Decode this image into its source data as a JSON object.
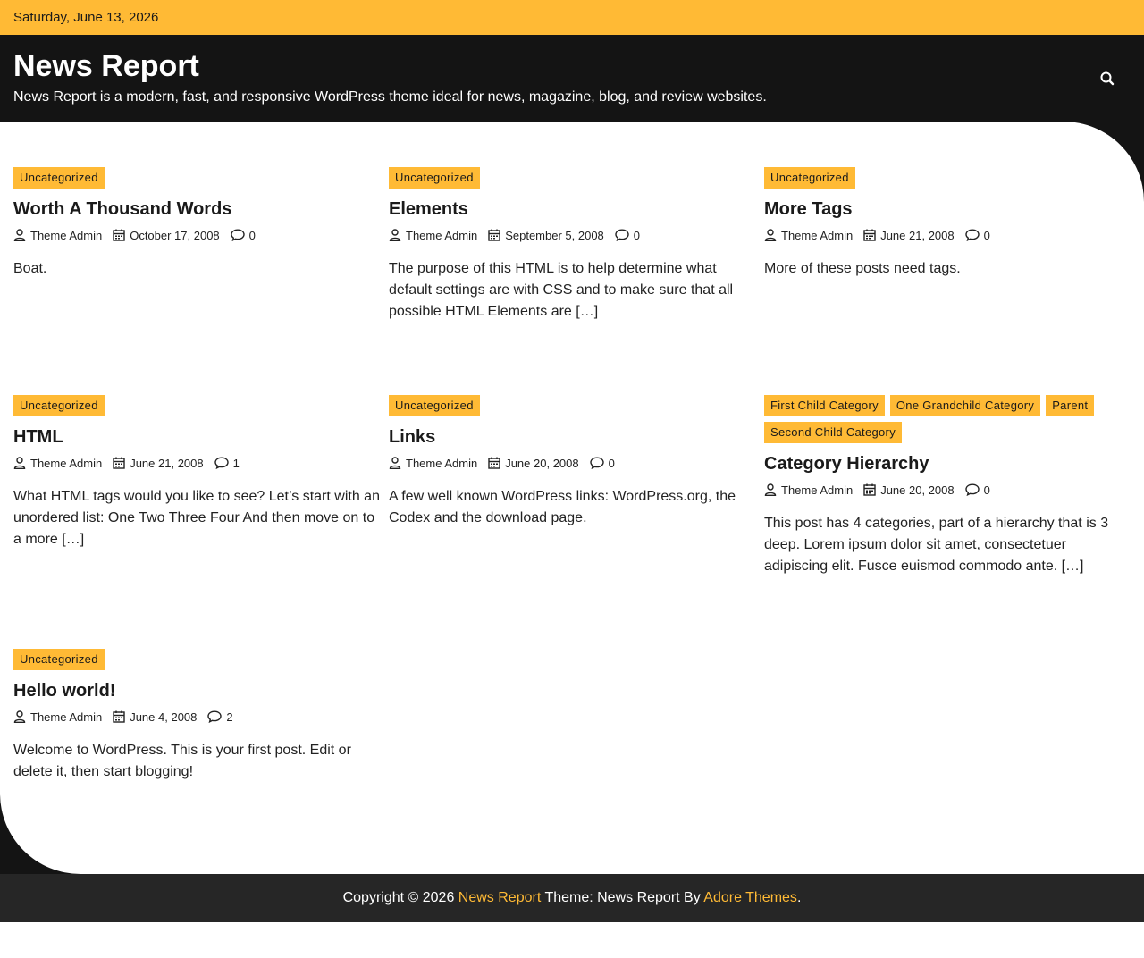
{
  "topbar": {
    "date": "Saturday, June 13, 2026"
  },
  "header": {
    "title": "News Report",
    "description": "News Report is a modern, fast, and responsive WordPress theme ideal for news, magazine, blog, and review websites.",
    "search_icon": "search-icon"
  },
  "colors": {
    "accent": "#ffba35",
    "dark": "#141414",
    "footer": "#262626"
  },
  "posts": [
    {
      "categories": [
        "Uncategorized"
      ],
      "title": "Worth A Thousand Words",
      "author": "Theme Admin",
      "date": "October 17, 2008",
      "comments": "0",
      "excerpt": "Boat."
    },
    {
      "categories": [
        "Uncategorized"
      ],
      "title": "Elements",
      "author": "Theme Admin",
      "date": "September 5, 2008",
      "comments": "0",
      "excerpt": "The purpose of this HTML is to help determine what default settings are with CSS and to make sure that all possible HTML Elements are […]"
    },
    {
      "categories": [
        "Uncategorized"
      ],
      "title": "More Tags",
      "author": "Theme Admin",
      "date": "June 21, 2008",
      "comments": "0",
      "excerpt": "More of these posts need tags."
    },
    {
      "categories": [
        "Uncategorized"
      ],
      "title": "HTML",
      "author": "Theme Admin",
      "date": "June 21, 2008",
      "comments": "1",
      "excerpt": "What HTML tags would you like to see? Let’s start with an unordered list: One Two Three Four And then move on to a more […]"
    },
    {
      "categories": [
        "Uncategorized"
      ],
      "title": "Links",
      "author": "Theme Admin",
      "date": "June 20, 2008",
      "comments": "0",
      "excerpt": "A few well known WordPress links: WordPress.org, the Codex and the download page."
    },
    {
      "categories": [
        "First Child Category",
        "One Grandchild Category",
        "Parent",
        "Second Child Category"
      ],
      "title": "Category Hierarchy",
      "author": "Theme Admin",
      "date": "June 20, 2008",
      "comments": "0",
      "excerpt": "This post has 4 categories, part of a hierarchy that is 3 deep. Lorem ipsum dolor sit amet, consectetuer adipiscing elit. Fusce euismod commodo ante. […]"
    },
    {
      "categories": [
        "Uncategorized"
      ],
      "title": "Hello world!",
      "author": "Theme Admin",
      "date": "June 4, 2008",
      "comments": "2",
      "excerpt": "Welcome to WordPress. This is your first post. Edit or delete it, then start blogging!"
    }
  ],
  "footer": {
    "copyright": "Copyright © 2026",
    "site_link": "News Report",
    "theme_text": "Theme: News Report By",
    "author_link": "Adore Themes",
    "end": "."
  }
}
